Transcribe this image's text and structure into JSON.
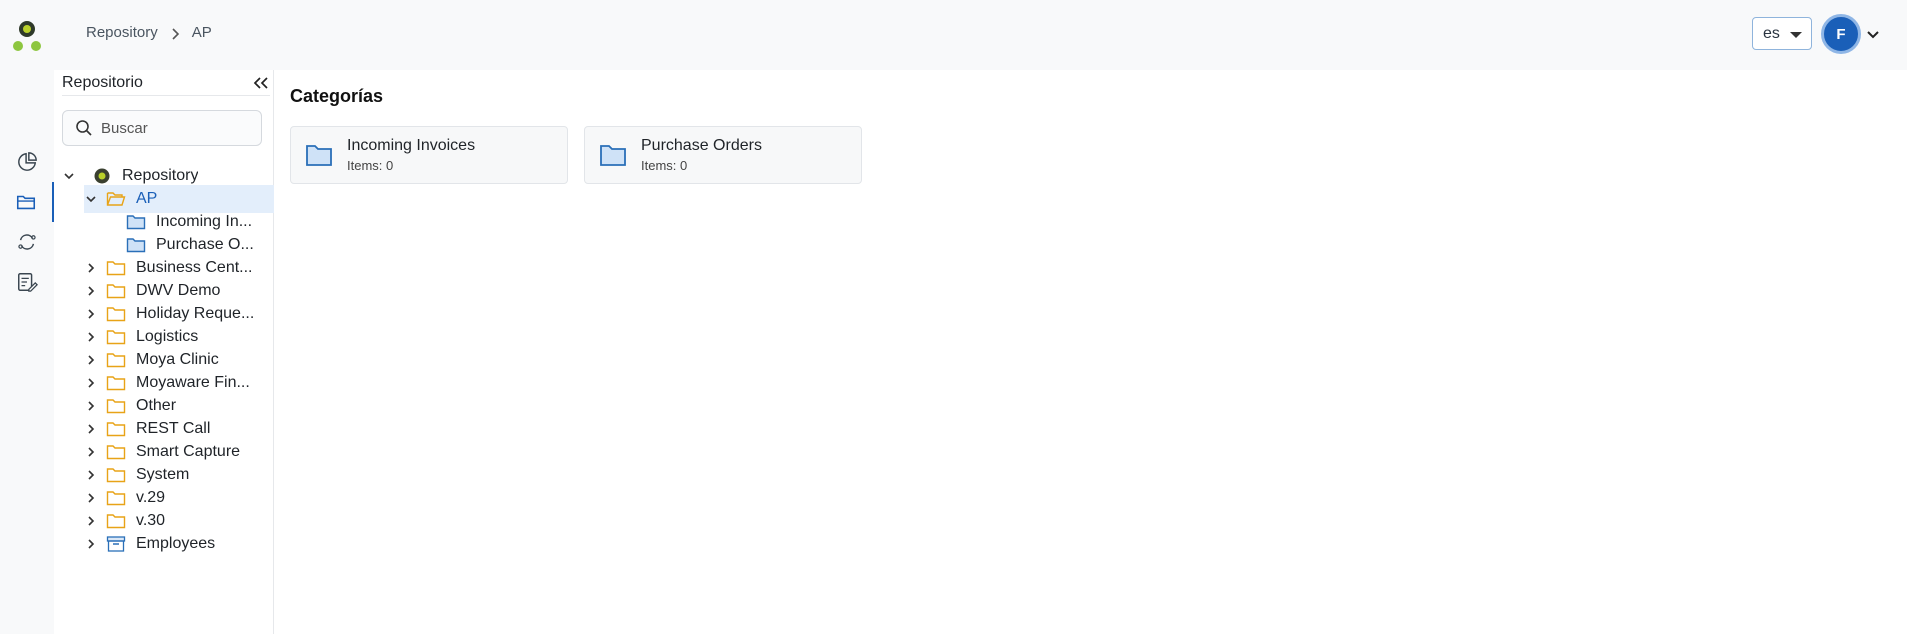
{
  "header": {
    "breadcrumb": [
      "Repository",
      "AP"
    ],
    "language": "es",
    "avatar_initial": "F"
  },
  "rail": {
    "items": [
      {
        "name": "dashboard",
        "icon": "pie-chart-icon"
      },
      {
        "name": "repository",
        "icon": "folders-icon",
        "active": true
      },
      {
        "name": "sync",
        "icon": "refresh-icon"
      },
      {
        "name": "tasks",
        "icon": "edit-document-icon"
      }
    ]
  },
  "sidebar": {
    "title": "Repositorio",
    "search_placeholder": "Buscar",
    "tree": [
      {
        "label": "Repository",
        "icon": "repository-logo-icon",
        "expanded": true
      },
      {
        "label": "AP",
        "icon": "open-folder-icon",
        "expanded": true,
        "selected": true
      },
      {
        "label": "Incoming In...",
        "icon": "category-folder-icon"
      },
      {
        "label": "Purchase O...",
        "icon": "category-folder-icon"
      },
      {
        "label": "Business Cent...",
        "icon": "folder-icon"
      },
      {
        "label": "DWV Demo",
        "icon": "folder-icon"
      },
      {
        "label": "Holiday Reque...",
        "icon": "folder-icon"
      },
      {
        "label": "Logistics",
        "icon": "folder-icon"
      },
      {
        "label": "Moya Clinic",
        "icon": "folder-icon"
      },
      {
        "label": "Moyaware Fin...",
        "icon": "folder-icon"
      },
      {
        "label": "Other",
        "icon": "folder-icon"
      },
      {
        "label": "REST Call",
        "icon": "folder-icon"
      },
      {
        "label": "Smart Capture",
        "icon": "folder-icon"
      },
      {
        "label": "System",
        "icon": "folder-icon"
      },
      {
        "label": "v.29",
        "icon": "folder-icon"
      },
      {
        "label": "v.30",
        "icon": "folder-icon"
      },
      {
        "label": "Employees",
        "icon": "archive-icon"
      }
    ]
  },
  "main": {
    "title": "Categorías",
    "cards": [
      {
        "title": "Incoming Invoices",
        "subtitle": "Items: 0"
      },
      {
        "title": "Purchase Orders",
        "subtitle": "Items: 0"
      }
    ]
  },
  "colors": {
    "accent": "#1a5fb8",
    "folder_yellow": "#e8a317",
    "folder_blue": "#2a6fb8",
    "logo_green": "#8dc63f"
  }
}
